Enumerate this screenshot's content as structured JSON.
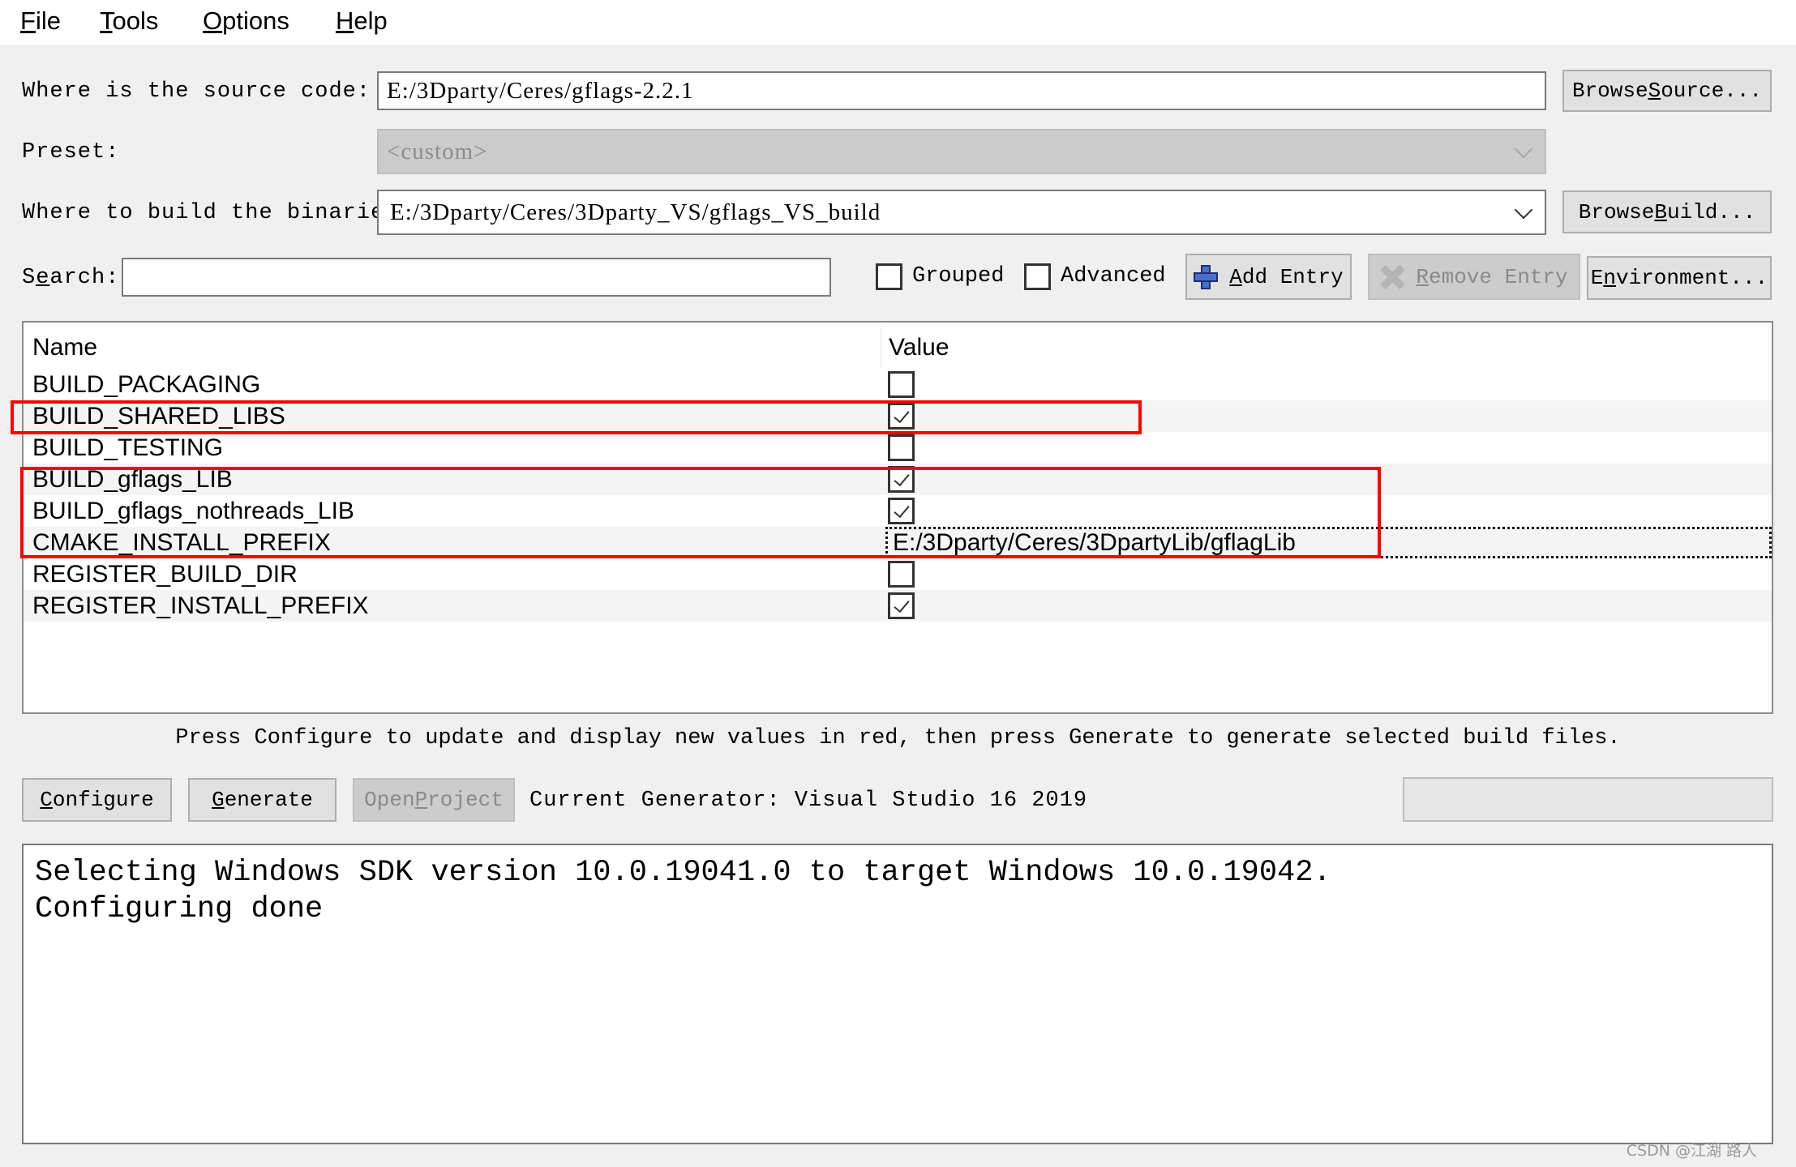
{
  "menu": {
    "items": [
      {
        "label": "File",
        "mnemonic": "F",
        "rest": "ile"
      },
      {
        "label": "Tools",
        "mnemonic": "T",
        "rest": "ools"
      },
      {
        "label": "Options",
        "mnemonic": "O",
        "rest": "ptions"
      },
      {
        "label": "Help",
        "mnemonic": "H",
        "rest": "elp"
      }
    ]
  },
  "source": {
    "label": "Where is the source code:",
    "value": "E:/3Dparty/Ceres/gflags-2.2.1",
    "browse_pre": "Browse ",
    "browse_mn": "S",
    "browse_post": "ource..."
  },
  "preset": {
    "label": "Preset:",
    "value": "<custom>"
  },
  "build": {
    "label": "Where to build the binaries:",
    "value": "E:/3Dparty/Ceres/3Dparty_VS/gflags_VS_build",
    "browse_pre": "Browse ",
    "browse_mn": "B",
    "browse_post": "uild..."
  },
  "search": {
    "label_pre": "S",
    "label_mn": "e",
    "label_post": "arch:",
    "value": "",
    "grouped_label": "Grouped",
    "grouped_checked": false,
    "advanced_label": "Advanced",
    "advanced_checked": false,
    "add_entry_mn": "A",
    "add_entry_post": "dd Entry",
    "remove_entry_mn": "R",
    "remove_entry_post": "emove Entry",
    "environment_pre": "E",
    "environment_mn": "n",
    "environment_post": "vironment..."
  },
  "table": {
    "headers": {
      "name": "Name",
      "value": "Value"
    },
    "rows": [
      {
        "name": "BUILD_PACKAGING",
        "type": "bool",
        "checked": false
      },
      {
        "name": "BUILD_SHARED_LIBS",
        "type": "bool",
        "checked": true
      },
      {
        "name": "BUILD_TESTING",
        "type": "bool",
        "checked": false
      },
      {
        "name": "BUILD_gflags_LIB",
        "type": "bool",
        "checked": true
      },
      {
        "name": "BUILD_gflags_nothreads_LIB",
        "type": "bool",
        "checked": true
      },
      {
        "name": "CMAKE_INSTALL_PREFIX",
        "type": "path",
        "value": "E:/3Dparty/Ceres/3DpartyLib/gflagLib"
      },
      {
        "name": "REGISTER_BUILD_DIR",
        "type": "bool",
        "checked": false
      },
      {
        "name": "REGISTER_INSTALL_PREFIX",
        "type": "bool",
        "checked": true
      }
    ],
    "highlight_color": "#ff0000"
  },
  "message": "Press Configure to update and display new values in red, then press Generate to generate selected build files.",
  "actions": {
    "configure_mn": "C",
    "configure_post": "onfigure",
    "generate_mn": "G",
    "generate_post": "enerate",
    "open_pre": "Open ",
    "open_mn": "P",
    "open_post": "roject",
    "generator": "Current Generator: Visual Studio 16 2019",
    "progress": 0
  },
  "output": {
    "lines": "Selecting Windows SDK version 10.0.19041.0 to target Windows 10.0.19042.\nConfiguring done"
  },
  "watermark": "CSDN @江湖 路人"
}
